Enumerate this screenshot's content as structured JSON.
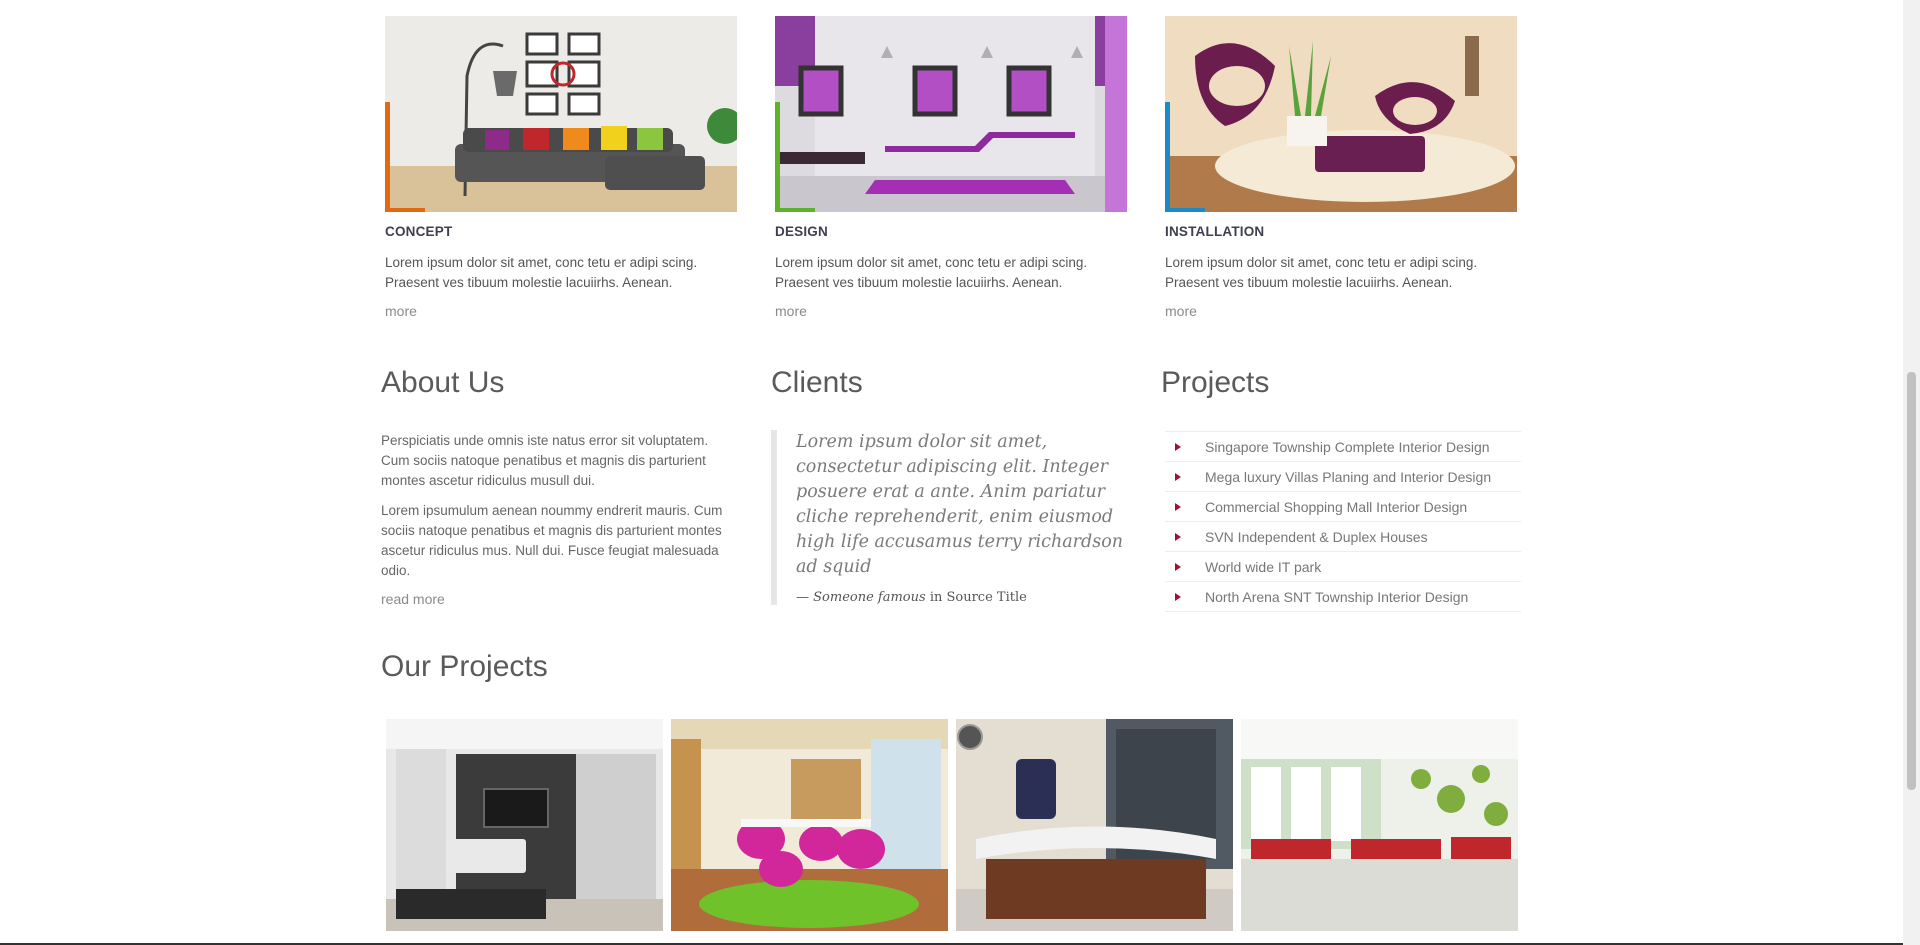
{
  "services": [
    {
      "title": "CONCEPT",
      "text": "Lorem ipsum dolor sit amet, conc tetu er adipi scing. Praesent ves tibuum molestie lacuiirhs. Aenean.",
      "link": "more",
      "accent": "#e06a12"
    },
    {
      "title": "DESIGN",
      "text": "Lorem ipsum dolor sit amet, conc tetu er adipi scing. Praesent ves tibuum molestie lacuiirhs. Aenean.",
      "link": "more",
      "accent": "#5cb32a"
    },
    {
      "title": "INSTALLATION",
      "text": "Lorem ipsum dolor sit amet, conc tetu er adipi scing. Praesent ves tibuum molestie lacuiirhs. Aenean.",
      "link": "more",
      "accent": "#1d8ac7"
    }
  ],
  "about": {
    "title": "About Us",
    "p1": "Perspiciatis unde omnis iste natus error sit voluptatem. Cum sociis natoque penatibus et magnis dis parturient montes ascetur ridiculus musull dui.",
    "p2": "Lorem ipsumulum aenean noummy endrerit mauris. Cum sociis natoque penatibus et magnis dis parturient montes ascetur ridiculus mus. Null dui. Fusce feugiat malesuada odio.",
    "link": "read more"
  },
  "clients": {
    "title": "Clients",
    "quote": "Lorem ipsum dolor sit amet, consectetur adipiscing elit. Integer posuere erat a ante. Anim pariatur cliche reprehenderit, enim eiusmod high life accusamus terry richardson ad squid",
    "cite_prefix": "— ",
    "cite_author": "Someone famous",
    "cite_in": " in ",
    "cite_source": "Source Title"
  },
  "projects": {
    "title": "Projects",
    "items": [
      "Singapore Township Complete Interior Design",
      "Mega luxury Villas Planing and Interior Design",
      "Commercial Shopping Mall Interior Design",
      "SVN Independent & Duplex Houses",
      "World wide IT park",
      "North Arena SNT Township Interior Design"
    ],
    "bullet_color": "#a01030"
  },
  "our_projects": {
    "title": "Our Projects"
  }
}
